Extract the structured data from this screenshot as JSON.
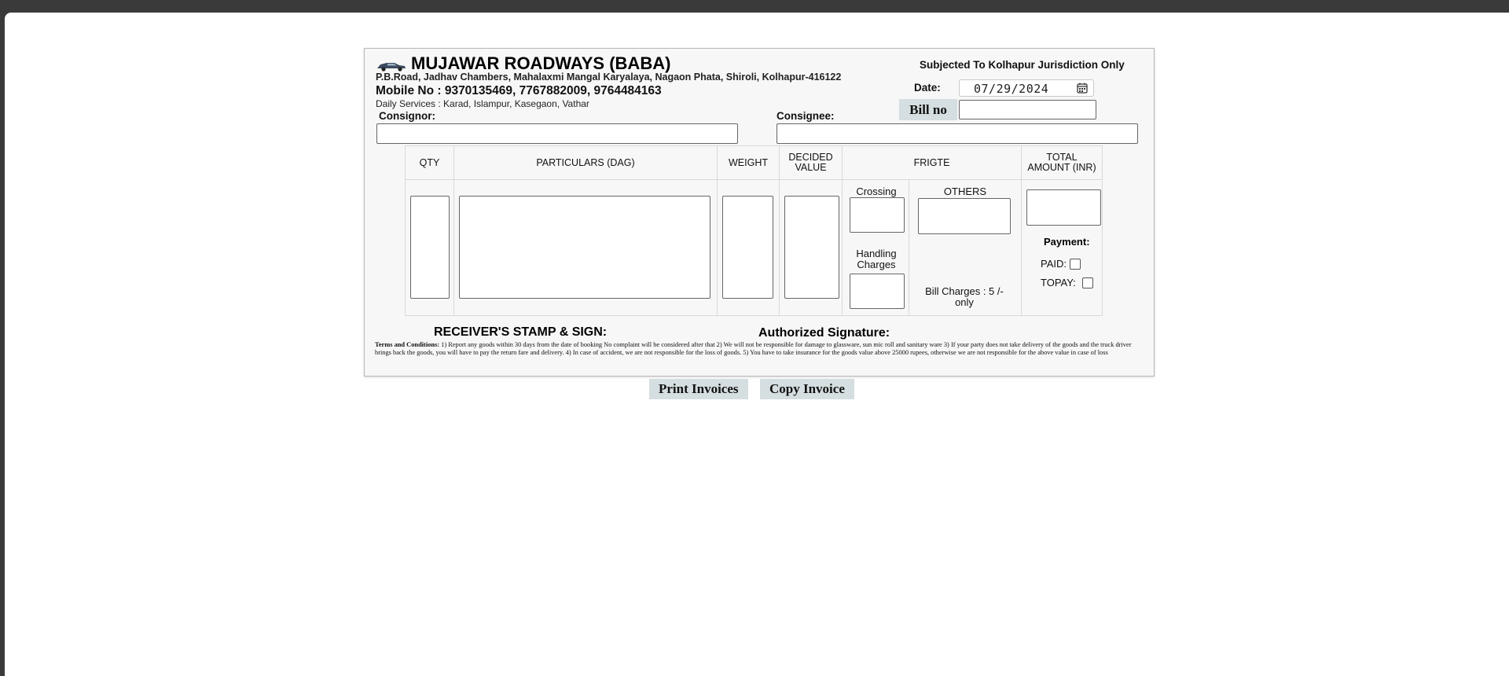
{
  "header": {
    "company_name": "MUJAWAR ROADWAYS (BABA)",
    "address": "P.B.Road, Jadhav Chambers, Mahalaxmi Mangal Karyalaya, Nagaon Phata, Shiroli, Kolhapur-416122",
    "mobile": "Mobile No : 9370135469, 7767882009, 9764484163",
    "services": "Daily Services : Karad, Islampur, Kasegaon, Vathar",
    "jurisdiction": "Subjected To Kolhapur Jurisdiction Only",
    "date_label": "Date:",
    "date_value": "07/29/2024",
    "bill_no_label": "Bill no"
  },
  "parties": {
    "consignor_label": "Consignor:",
    "consignee_label": "Consignee:"
  },
  "goods_table": {
    "columns": [
      "QTY",
      "PARTICULARS (DAG)",
      "WEIGHT",
      "DECIDED VALUE",
      "FRIGTE",
      "TOTAL AMOUNT (INR)"
    ],
    "crossing_label": "Crossing",
    "others_label": "OTHERS",
    "handling_label": "Handling Charges",
    "bill_charges": "Bill Charges : 5 /- only",
    "payment_label": "Payment:",
    "paid_label": "PAID:",
    "topay_label": "TOPAY:"
  },
  "footer": {
    "receiver": "RECEIVER'S STAMP & SIGN:",
    "authorized": "Authorized Signature:",
    "terms_title": "Terms and Conditions:",
    "terms_text": " 1) Report any goods within 30 days from the date of booking No complaint will be considered after that 2) We will not be responsible for damage to glassware, sun mic roll and sanitary ware 3) If your party does not take delivery of the goods and the truck driver brings back the goods, you will have to pay the return fare and delivery. 4) In case of accident, we are not responsible for the loss of goods. 5) You have to take insurance for the goods value above 25000 rupees, otherwise we are not responsible for the above value in case of loss"
  },
  "actions": {
    "print_label": "Print Invoices",
    "copy_label": "Copy Invoice"
  },
  "icons": {
    "logo": "truck-icon",
    "date_picker": "calendar-icon"
  },
  "colors": {
    "label_bg": "#d5dee0",
    "form_bg": "#f7f7f7",
    "frame_bg": "#3a3a3a"
  }
}
